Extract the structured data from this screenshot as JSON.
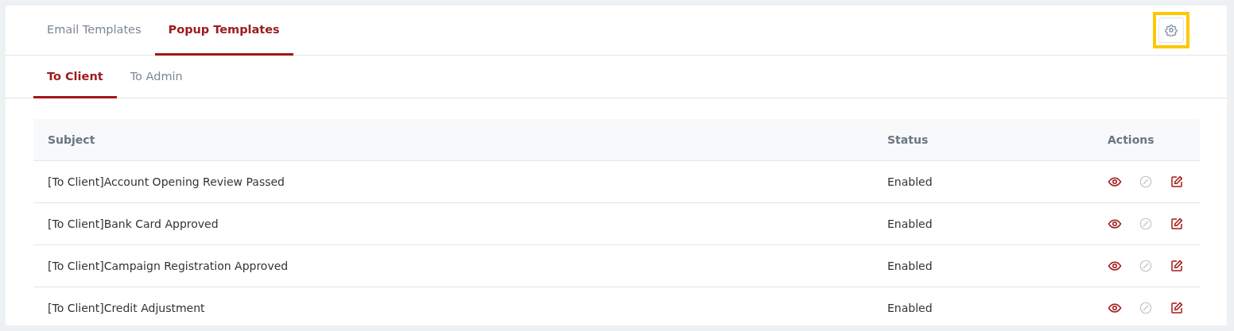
{
  "tabs": [
    {
      "label": "Email Templates",
      "selected": false
    },
    {
      "label": "Popup Templates",
      "selected": true
    }
  ],
  "settings_button": {
    "highlighted": true
  },
  "subtabs": [
    {
      "label": "To Client",
      "selected": true
    },
    {
      "label": "To Admin",
      "selected": false
    }
  ],
  "table": {
    "columns": [
      "Subject",
      "Status",
      "Actions"
    ],
    "rows": [
      {
        "subject": "[To Client]Account Opening Review Passed",
        "status": "Enabled",
        "actions": [
          {
            "kind": "view",
            "disabled": false
          },
          {
            "kind": "disable",
            "disabled": true
          },
          {
            "kind": "edit",
            "disabled": false
          }
        ]
      },
      {
        "subject": "[To Client]Bank Card Approved",
        "status": "Enabled",
        "actions": [
          {
            "kind": "view",
            "disabled": false
          },
          {
            "kind": "disable",
            "disabled": true
          },
          {
            "kind": "edit",
            "disabled": false
          }
        ]
      },
      {
        "subject": "[To Client]Campaign Registration Approved",
        "status": "Enabled",
        "actions": [
          {
            "kind": "view",
            "disabled": false
          },
          {
            "kind": "disable",
            "disabled": true
          },
          {
            "kind": "edit",
            "disabled": false
          }
        ]
      },
      {
        "subject": "[To Client]Credit Adjustment",
        "status": "Enabled",
        "actions": [
          {
            "kind": "view",
            "disabled": false
          },
          {
            "kind": "disable",
            "disabled": true
          },
          {
            "kind": "edit",
            "disabled": false
          }
        ]
      }
    ]
  }
}
